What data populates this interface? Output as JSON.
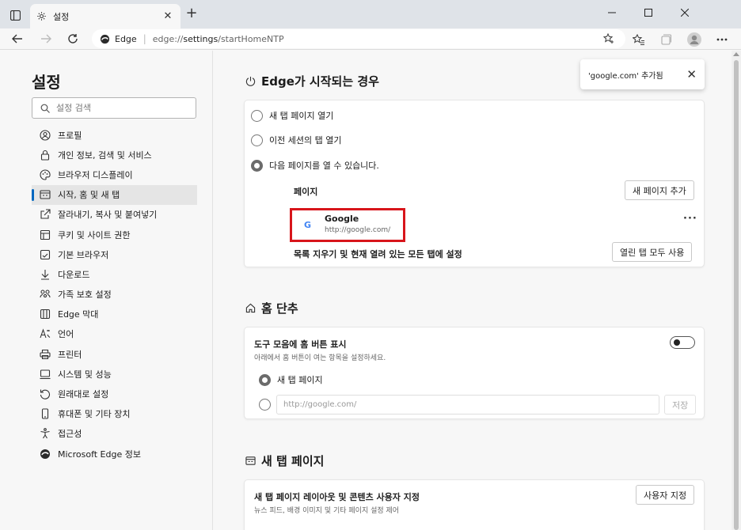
{
  "window": {
    "tab_title": "설정",
    "tab_close": "✕",
    "new_tab": "+"
  },
  "addressbar": {
    "site_name": "Edge",
    "url_prefix": "edge://",
    "url_path": "settings",
    "url_suffix": "/startHomeNTP"
  },
  "sidebar": {
    "title": "설정",
    "search_placeholder": "설정 검색",
    "items": [
      {
        "label": "프로필",
        "icon": "profile-icon"
      },
      {
        "label": "개인 정보, 검색 및 서비스",
        "icon": "lock-icon"
      },
      {
        "label": "브라우저 디스플레이",
        "icon": "palette-icon"
      },
      {
        "label": "시작, 홈 및 새 탭",
        "icon": "start-icon",
        "active": true
      },
      {
        "label": "잘라내기, 복사 및 붙여넣기",
        "icon": "share-icon"
      },
      {
        "label": "쿠키 및 사이트 권한",
        "icon": "cookie-icon"
      },
      {
        "label": "기본 브라우저",
        "icon": "browser-icon"
      },
      {
        "label": "다운로드",
        "icon": "download-icon"
      },
      {
        "label": "가족 보호 설정",
        "icon": "family-icon"
      },
      {
        "label": "Edge 막대",
        "icon": "edge-bar-icon"
      },
      {
        "label": "언어",
        "icon": "language-icon"
      },
      {
        "label": "프린터",
        "icon": "printer-icon"
      },
      {
        "label": "시스템 및 성능",
        "icon": "system-icon"
      },
      {
        "label": "원래대로 설정",
        "icon": "reset-icon"
      },
      {
        "label": "휴대폰 및 기타 장치",
        "icon": "phone-icon"
      },
      {
        "label": "접근성",
        "icon": "accessibility-icon"
      },
      {
        "label": "Microsoft Edge 정보",
        "icon": "edge-logo-icon"
      }
    ]
  },
  "startup": {
    "title": "Edge가 시작되는 경우",
    "option_newtab": "새 탭 페이지 열기",
    "option_previous": "이전 세션의 탭 열기",
    "option_pages": "다음 페이지를 열 수 있습니다.",
    "pages_label": "페이지",
    "add_page_button": "새 페이지 추가",
    "page_name": "Google",
    "page_url": "http://google.com/",
    "page_favicon": "G",
    "more": "···",
    "clear_label": "목록 지우기 및 현재 열려 있는 모든 탭에 설정",
    "use_all_tabs_button": "열린 탭 모두 사용"
  },
  "home": {
    "title": "홈 단추",
    "show_toolbar_label": "도구 모음에 홈 버튼 표시",
    "show_toolbar_sub": "아래에서 홈 버튼이 여는 항목을 설정하세요.",
    "option_newtab": "새 탭 페이지",
    "url_placeholder": "http://google.com/",
    "save_button": "저장"
  },
  "newtab": {
    "title": "새 탭 페이지",
    "customize_label": "새 탭 페이지 레이아웃 및 콘텐츠 사용자 지정",
    "customize_sub": "뉴스 피드, 배경 이미지 및 기타 페이지 설정 제어",
    "customize_button": "사용자 지정"
  },
  "toast": {
    "text": "'google.com' 추가됨",
    "close": "✕"
  },
  "colors": {
    "accent": "#0067c0",
    "highlight": "#d8151b"
  }
}
